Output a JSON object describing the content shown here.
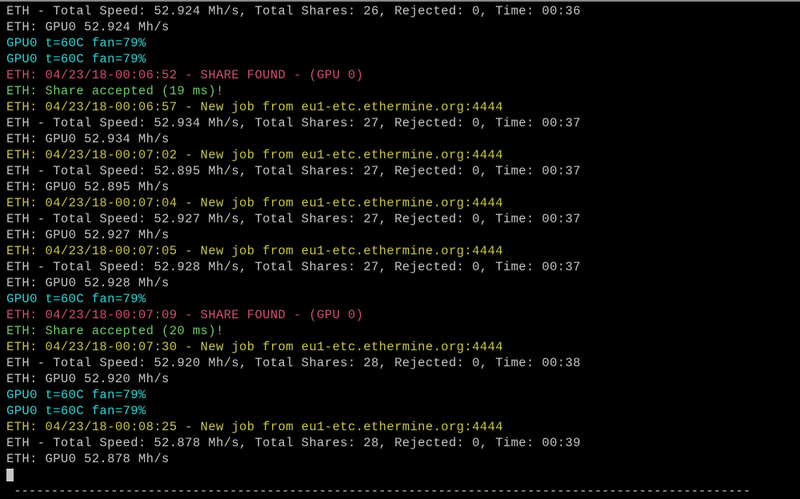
{
  "lines": [
    {
      "cls": "white",
      "text": "ETH - Total Speed: 52.924 Mh/s, Total Shares: 26, Rejected: 0, Time: 00:36"
    },
    {
      "cls": "white",
      "text": "ETH: GPU0 52.924 Mh/s"
    },
    {
      "cls": "cyan",
      "text": "GPU0 t=60C fan=79%"
    },
    {
      "cls": "cyan",
      "text": "GPU0 t=60C fan=79%"
    },
    {
      "cls": "magenta",
      "text": "ETH: 04/23/18-00:06:52 - SHARE FOUND - (GPU 0)"
    },
    {
      "cls": "green",
      "text": "ETH: Share accepted (19 ms)!"
    },
    {
      "cls": "yellow",
      "text": "ETH: 04/23/18-00:06:57 - New job from eu1-etc.ethermine.org:4444"
    },
    {
      "cls": "white",
      "text": "ETH - Total Speed: 52.934 Mh/s, Total Shares: 27, Rejected: 0, Time: 00:37"
    },
    {
      "cls": "white",
      "text": "ETH: GPU0 52.934 Mh/s"
    },
    {
      "cls": "yellow",
      "text": "ETH: 04/23/18-00:07:02 - New job from eu1-etc.ethermine.org:4444"
    },
    {
      "cls": "white",
      "text": "ETH - Total Speed: 52.895 Mh/s, Total Shares: 27, Rejected: 0, Time: 00:37"
    },
    {
      "cls": "white",
      "text": "ETH: GPU0 52.895 Mh/s"
    },
    {
      "cls": "yellow",
      "text": "ETH: 04/23/18-00:07:04 - New job from eu1-etc.ethermine.org:4444"
    },
    {
      "cls": "white",
      "text": "ETH - Total Speed: 52.927 Mh/s, Total Shares: 27, Rejected: 0, Time: 00:37"
    },
    {
      "cls": "white",
      "text": "ETH: GPU0 52.927 Mh/s"
    },
    {
      "cls": "yellow",
      "text": "ETH: 04/23/18-00:07:05 - New job from eu1-etc.ethermine.org:4444"
    },
    {
      "cls": "white",
      "text": "ETH - Total Speed: 52.928 Mh/s, Total Shares: 27, Rejected: 0, Time: 00:37"
    },
    {
      "cls": "white",
      "text": "ETH: GPU0 52.928 Mh/s"
    },
    {
      "cls": "cyan",
      "text": "GPU0 t=60C fan=79%"
    },
    {
      "cls": "magenta",
      "text": "ETH: 04/23/18-00:07:09 - SHARE FOUND - (GPU 0)"
    },
    {
      "cls": "green",
      "text": "ETH: Share accepted (20 ms)!"
    },
    {
      "cls": "yellow",
      "text": "ETH: 04/23/18-00:07:30 - New job from eu1-etc.ethermine.org:4444"
    },
    {
      "cls": "white",
      "text": "ETH - Total Speed: 52.920 Mh/s, Total Shares: 28, Rejected: 0, Time: 00:38"
    },
    {
      "cls": "white",
      "text": "ETH: GPU0 52.920 Mh/s"
    },
    {
      "cls": "cyan",
      "text": "GPU0 t=60C fan=79%"
    },
    {
      "cls": "cyan",
      "text": "GPU0 t=60C fan=79%"
    },
    {
      "cls": "yellow",
      "text": "ETH: 04/23/18-00:08:25 - New job from eu1-etc.ethermine.org:4444"
    },
    {
      "cls": "white",
      "text": "ETH - Total Speed: 52.878 Mh/s, Total Shares: 28, Rejected: 0, Time: 00:39"
    },
    {
      "cls": "white",
      "text": "ETH: GPU0 52.878 Mh/s"
    }
  ],
  "separator": " ---------------------------------------------------------------------------------------------------"
}
